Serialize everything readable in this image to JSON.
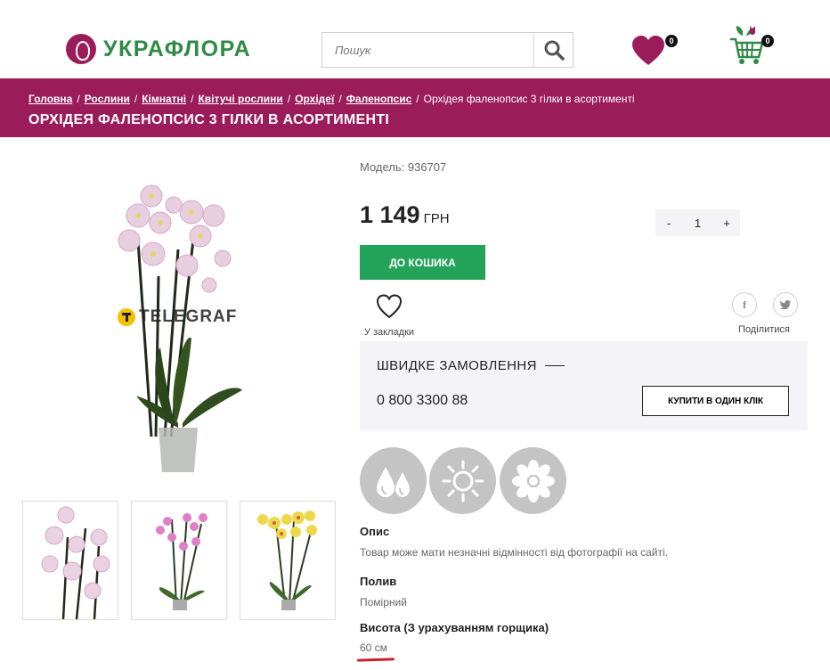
{
  "header": {
    "logo_text": "УКРАФЛОРА",
    "search_placeholder": "Пошук",
    "wishlist_count": "0",
    "cart_count": "0"
  },
  "breadcrumb": [
    {
      "label": "Головна"
    },
    {
      "label": "Рослини"
    },
    {
      "label": "Кімнатні"
    },
    {
      "label": "Квітучі рослини"
    },
    {
      "label": "Орхідеї"
    },
    {
      "label": "Фаленопсис"
    },
    {
      "label": "Орхідея фаленопсис 3 гілки в асортименті"
    }
  ],
  "product": {
    "title": "ОРХІДЕЯ ФАЛЕНОПСИС 3 ГІЛКИ В АСОРТИМЕНТІ",
    "model": "Модель: 936707",
    "price": "1 149",
    "currency": "ГРН",
    "qty_minus": "-",
    "qty_value": "1",
    "qty_plus": "+",
    "add_to_cart": "ДО КОШИКА",
    "bookmark_label": "У закладки",
    "share_label": "Поділитися",
    "watermark": "TELEGRAF"
  },
  "quick_order": {
    "title": "ШВИДКЕ ЗАМОВЛЕННЯ",
    "phone": "0 800 3300 88",
    "button": "КУПИТИ В ОДИН КЛІК"
  },
  "care_icons": [
    "water-drops-icon",
    "sun-icon",
    "flower-icon"
  ],
  "attributes": [
    {
      "name": "Опис",
      "value": "Товар може мати незначні відмінності від фотографії на сайті."
    },
    {
      "name": "Полив",
      "value": "Помірний"
    },
    {
      "name": "Висота (З урахуванням горщика)",
      "value": "60 см"
    }
  ],
  "colors": {
    "brand": "#9b1c5a",
    "logo_green": "#2e8b45",
    "button_green": "#23a35a",
    "highlight_red": "#d11f2a"
  }
}
